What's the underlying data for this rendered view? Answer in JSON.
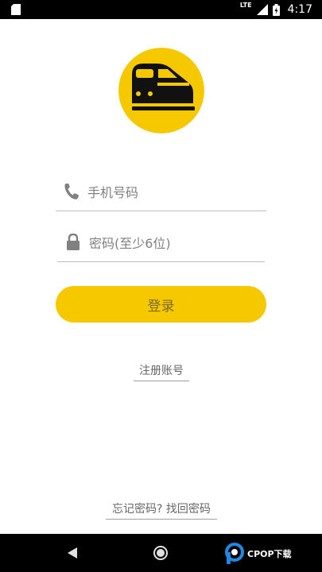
{
  "status_bar": {
    "network_label": "LTE",
    "time": "4:17",
    "icons": [
      "sim-card-icon",
      "signal-icon",
      "battery-icon"
    ]
  },
  "logo": {
    "icon": "train-icon",
    "color": "#f5c800"
  },
  "form": {
    "phone": {
      "icon": "phone-icon",
      "placeholder": "手机号码",
      "value": ""
    },
    "password": {
      "icon": "lock-icon",
      "placeholder": "密码(至少6位)",
      "value": ""
    },
    "login_label": "登录"
  },
  "links": {
    "register": "注册账号",
    "forgot": "忘记密码? 找回密码"
  },
  "nav_bar": {
    "icons": [
      "back-icon",
      "home-icon"
    ]
  },
  "watermark": {
    "text": "CPOP下载"
  },
  "colors": {
    "accent": "#f5c800",
    "divider": "#bdbdbd",
    "placeholder": "#808080"
  }
}
